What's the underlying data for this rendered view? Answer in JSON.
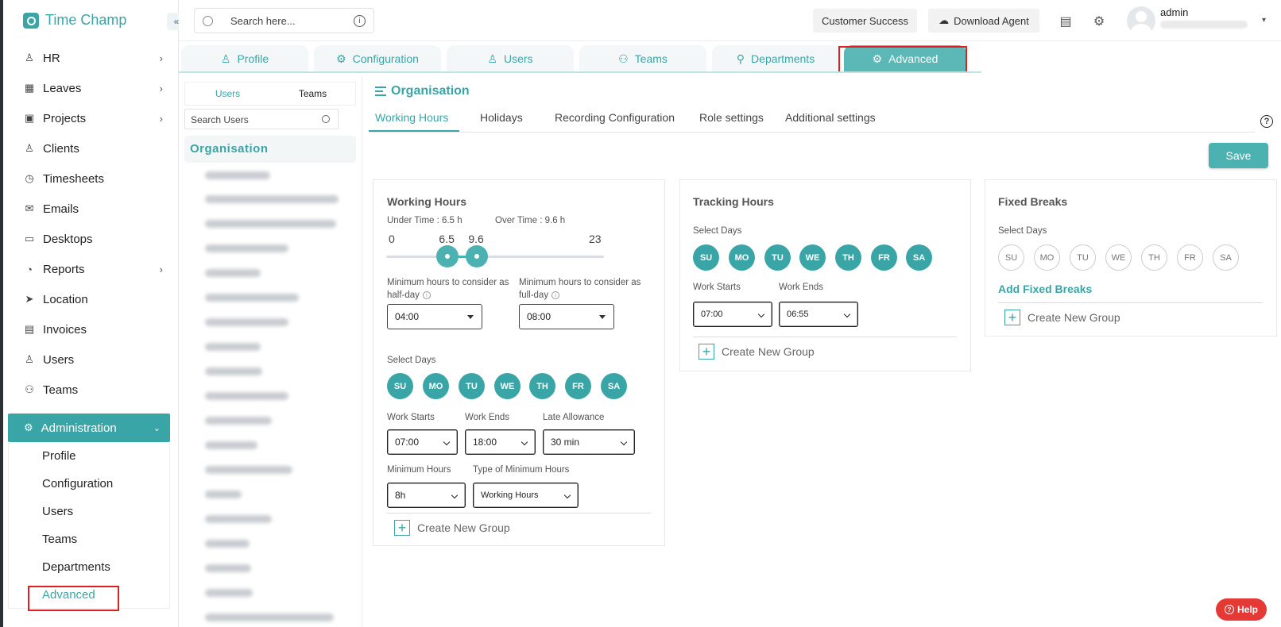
{
  "app": {
    "name": "Time Champ",
    "collapse_icon": "«"
  },
  "sidebar": {
    "items": [
      {
        "label": "HR",
        "icon": "person-icon",
        "chevron": "›"
      },
      {
        "label": "Leaves",
        "icon": "calendar-icon",
        "chevron": "›"
      },
      {
        "label": "Projects",
        "icon": "briefcase-icon",
        "chevron": "›"
      },
      {
        "label": "Clients",
        "icon": "client-icon"
      },
      {
        "label": "Timesheets",
        "icon": "alarm-icon"
      },
      {
        "label": "Emails",
        "icon": "mail-icon"
      },
      {
        "label": "Desktops",
        "icon": "monitor-icon"
      },
      {
        "label": "Reports",
        "icon": "pie-chart-icon",
        "chevron": "›"
      },
      {
        "label": "Location",
        "icon": "location-arrow-icon"
      },
      {
        "label": "Invoices",
        "icon": "invoice-icon"
      },
      {
        "label": "Users",
        "icon": "users-icon"
      },
      {
        "label": "Teams",
        "icon": "teams-icon"
      }
    ],
    "administration": {
      "label": "Administration",
      "icon": "gear-icon",
      "chevron": "⌄"
    },
    "sub_items": [
      "Profile",
      "Configuration",
      "Users",
      "Teams",
      "Departments",
      "Advanced"
    ]
  },
  "header": {
    "search_placeholder": "Search here...",
    "info_glyph": "i",
    "customer_success": "Customer Success",
    "download_agent": "Download Agent",
    "user_name": "admin",
    "caret": "▾"
  },
  "top_tabs": [
    "Profile",
    "Configuration",
    "Users",
    "Teams",
    "Departments",
    "Advanced"
  ],
  "users_panel": {
    "tabs": [
      "Users",
      "Teams"
    ],
    "search_placeholder": "Search Users",
    "org_label": "Organisation"
  },
  "main": {
    "title": "Organisation",
    "sub_tabs": [
      "Working Hours",
      "Holidays",
      "Recording Configuration",
      "Role settings",
      "Additional settings"
    ],
    "help_glyph": "?",
    "save_label": "Save"
  },
  "working_hours": {
    "title": "Working Hours",
    "under_time": "Under Time : 6.5 h",
    "over_time": "Over Time : 9.6 h",
    "slider": {
      "min": 0,
      "max": 23,
      "low": 6.5,
      "high": 9.6,
      "min_label": "0",
      "max_label": "23",
      "low_label": "6.5",
      "high_label": "9.6"
    },
    "half_day_label": "Minimum hours to consider as half-day",
    "full_day_label": "Minimum hours to consider as full-day",
    "half_day_value": "04:00",
    "full_day_value": "08:00",
    "select_days_label": "Select Days",
    "days": [
      "SU",
      "MO",
      "TU",
      "WE",
      "TH",
      "FR",
      "SA"
    ],
    "work_starts_label": "Work Starts",
    "work_ends_label": "Work Ends",
    "late_allowance_label": "Late Allowance",
    "work_starts": "07:00",
    "work_ends": "18:00",
    "late_allowance": "30 min",
    "min_hours_label": "Minimum Hours",
    "min_type_label": "Type of Minimum Hours",
    "min_hours": "8h",
    "min_type": "Working Hours",
    "create_group": "Create New Group"
  },
  "tracking_hours": {
    "title": "Tracking Hours",
    "select_days_label": "Select Days",
    "days": [
      "SU",
      "MO",
      "TU",
      "WE",
      "TH",
      "FR",
      "SA"
    ],
    "work_starts_label": "Work Starts",
    "work_ends_label": "Work Ends",
    "work_starts": "07:00",
    "work_ends": "06:55",
    "create_group": "Create New Group"
  },
  "fixed_breaks": {
    "title": "Fixed Breaks",
    "select_days_label": "Select Days",
    "days": [
      "SU",
      "MO",
      "TU",
      "WE",
      "TH",
      "FR",
      "SA"
    ],
    "add_label": "Add Fixed Breaks",
    "create_group": "Create New Group"
  },
  "help_button": {
    "label": "Help",
    "glyph": "?"
  },
  "colors": {
    "accent": "#3aa5a6",
    "highlight_box": "#e02020",
    "help": "#e53935"
  }
}
